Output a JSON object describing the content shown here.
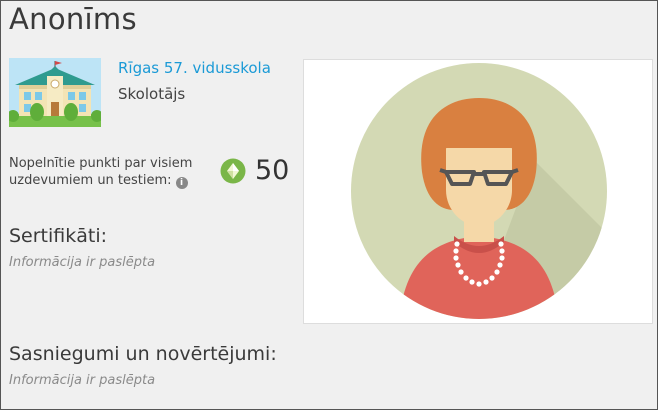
{
  "profile": {
    "name": "Anonīms"
  },
  "school": {
    "name": "Rīgas 57. vidusskola",
    "role": "Skolotājs"
  },
  "points": {
    "label": "Nopelnītie punkti par visiem uzdevumiem un testiem:",
    "info_icon": "i",
    "value": "50"
  },
  "certificates": {
    "heading": "Sertifikāti:",
    "note": "Informācija ir paslēpta"
  },
  "achievements": {
    "heading": "Sasniegumi un novērtējumi:",
    "note": "Informācija ir paslēpta"
  },
  "icons": {
    "gem": "green-diamond-badge-icon",
    "info": "info-circle-icon"
  },
  "colors": {
    "link": "#1b9ad6",
    "gem_green": "#7ab648",
    "avatar_bg": "#d3d9b4",
    "hair": "#d98040",
    "sweater": "#e0645a"
  }
}
